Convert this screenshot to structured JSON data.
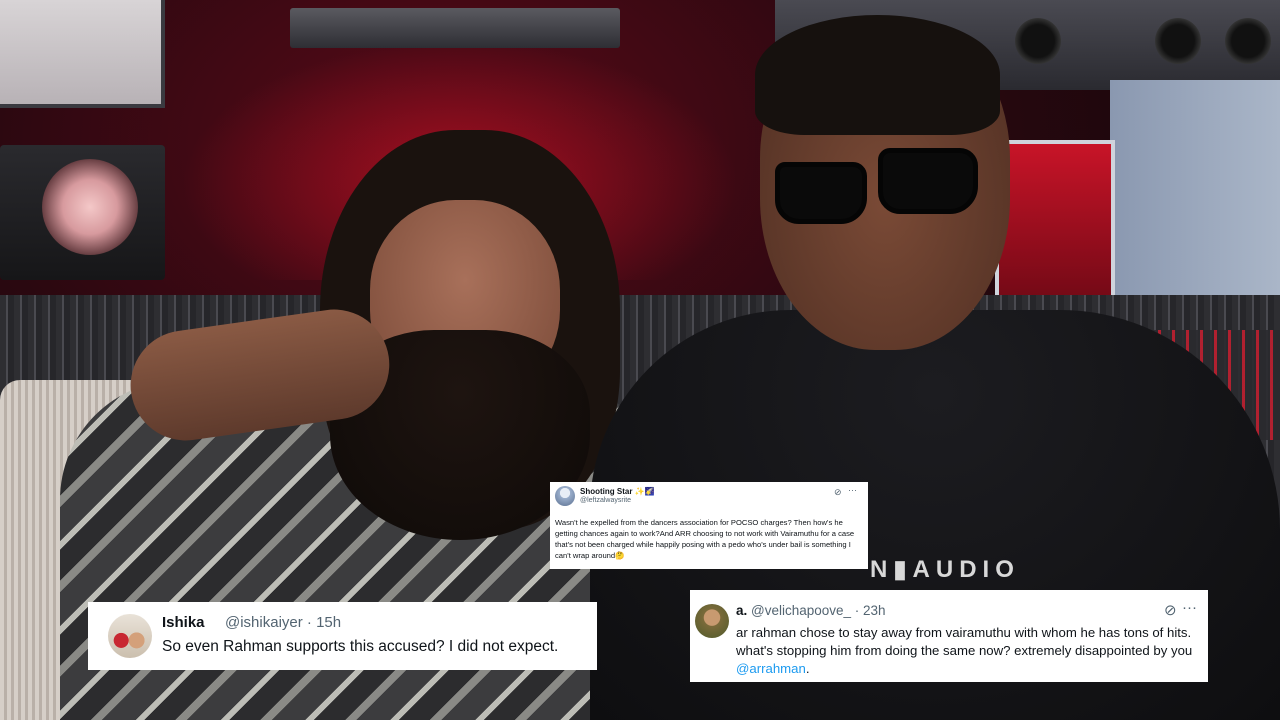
{
  "photo": {
    "shirt_print": "N▮AUDIO"
  },
  "tweets": {
    "star": {
      "name": "Shooting Star",
      "name_emoji": "✨🌠",
      "handle": "@leftzalwaysrite",
      "grok_icon": "grok-icon",
      "more_icon": "more-icon",
      "body": "Wasn't he expelled from the dancers association for POCSO charges? Then how's he getting chances again to work?And ARR choosing to not work with Vairamuthu for a case that's not been charged while happily posing with a pedo who's under bail is something I can't wrap around🤔"
    },
    "ishika": {
      "name": "Ishika",
      "handle": "@ishikaiyer · 15h",
      "body": "So even Rahman supports this accused? I did not expect."
    },
    "a": {
      "name": "a.",
      "handle": "@velichapoove_ · 23h",
      "grok_icon": "grok-icon",
      "more_icon": "more-icon",
      "body": "ar rahman chose to stay away from vairamuthu with whom he has tons of hits. what's stopping him from doing the same now? extremely disappointed by you ",
      "mention": "@arrahman",
      "body_end": "."
    }
  }
}
